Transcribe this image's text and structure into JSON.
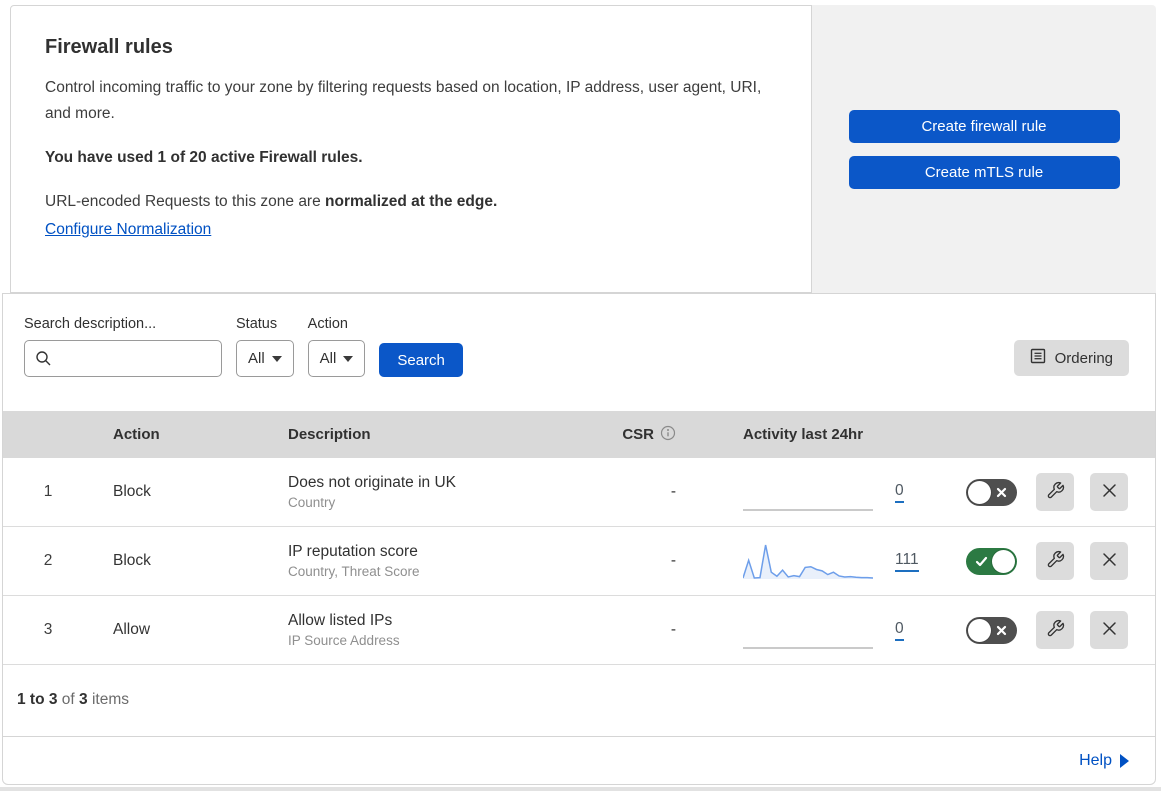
{
  "intro": {
    "title": "Firewall rules",
    "description": "Control incoming traffic to your zone by filtering requests based on location, IP address, user agent, URI, and more.",
    "usage_bold": "You have used 1 of 20 active Firewall rules.",
    "normalization_prefix": "URL-encoded Requests to this zone are ",
    "normalization_bold": "normalized at the edge.",
    "normalization_link": "Configure Normalization"
  },
  "cta": {
    "create_firewall_rule": "Create firewall rule",
    "create_mtls_rule": "Create mTLS rule"
  },
  "filters": {
    "search_label": "Search description...",
    "search_value": "",
    "status_label": "Status",
    "status_value": "All",
    "action_label": "Action",
    "action_value": "All",
    "search_button": "Search",
    "ordering_button": "Ordering"
  },
  "table": {
    "headers": {
      "action": "Action",
      "description": "Description",
      "csr": "CSR",
      "activity": "Activity last 24hr"
    },
    "rows": [
      {
        "priority": "1",
        "action": "Block",
        "description": "Does not originate in UK",
        "fields": "Country",
        "csr": "-",
        "activity_count": "0",
        "enabled": false,
        "sparkline": [
          0,
          0
        ]
      },
      {
        "priority": "2",
        "action": "Block",
        "description": "IP reputation score",
        "fields": "Country, Threat Score",
        "csr": "-",
        "activity_count": "111",
        "enabled": true,
        "sparkline": [
          3,
          55,
          3,
          4,
          100,
          20,
          8,
          26,
          6,
          10,
          7,
          34,
          36,
          28,
          24,
          13,
          20,
          9,
          6,
          7,
          5,
          4,
          4,
          3
        ]
      },
      {
        "priority": "3",
        "action": "Allow",
        "description": "Allow listed IPs",
        "fields": "IP Source Address",
        "csr": "-",
        "activity_count": "0",
        "enabled": false,
        "sparkline": [
          0,
          0
        ]
      }
    ],
    "summary": {
      "range": "1 to 3",
      "of": "of",
      "total": "3",
      "items": "items"
    }
  },
  "help": {
    "label": "Help"
  },
  "colors": {
    "accent_blue": "#0b57c8",
    "link_blue": "#0051c3",
    "toggle_on_green": "#2c7a43",
    "toggle_off_gray": "#4f4f4f",
    "sparkline_blue": "#6d9eea",
    "sparkline_fill": "#e9f0fb",
    "flatline_gray": "#b9b9b9",
    "header_band_gray": "#d9d9d9"
  }
}
